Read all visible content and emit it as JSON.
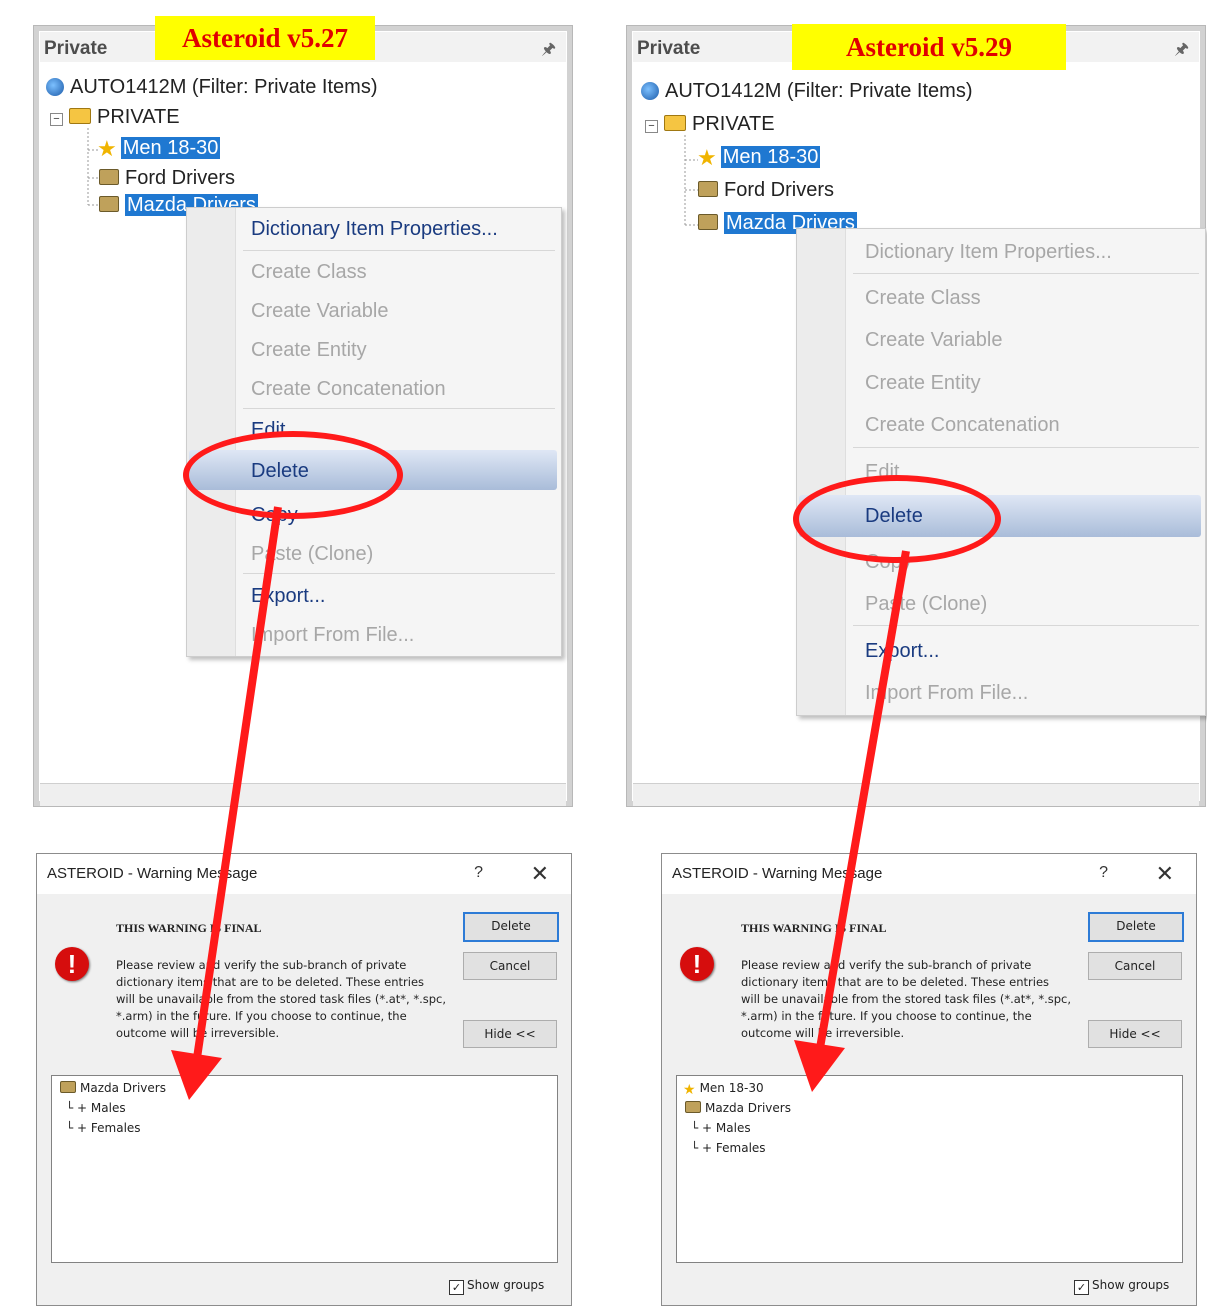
{
  "left": {
    "version": "Asteroid v5.27",
    "panel_title": "Private",
    "tree": {
      "root": "AUTO1412M (Filter: Private Items)",
      "folder": "PRIVATE",
      "items": [
        "Men 18-30",
        "Ford Drivers",
        "Mazda Drivers"
      ]
    },
    "menu": {
      "properties": "Dictionary Item Properties...",
      "create_class": "Create Class",
      "create_variable": "Create Variable",
      "create_entity": "Create Entity",
      "create_concatenation": "Create Concatenation",
      "edit": "Edit",
      "delete": "Delete",
      "copy": "Copy",
      "paste": "Paste (Clone)",
      "export": "Export...",
      "import": "Import From File..."
    },
    "dialog": {
      "title": "ASTEROID - Warning Message",
      "help": "?",
      "close": "✕",
      "heading": "THIS WARNING IS FINAL",
      "body": "Please review and verify the sub-branch of private dictionary items that are to be deleted. These entries will be unavailable from the stored task files (*.at*, *.spc, *.arm) in the future. If you choose to continue, the outcome will be irreversible.",
      "delete": "Delete",
      "cancel": "Cancel",
      "hide": "Hide <<",
      "list": [
        "Mazda Drivers",
        "Males",
        "Females"
      ],
      "show_groups": "Show groups"
    }
  },
  "right": {
    "version": "Asteroid v5.29",
    "panel_title": "Private",
    "tree": {
      "root": "AUTO1412M (Filter: Private Items)",
      "folder": "PRIVATE",
      "items": [
        "Men 18-30",
        "Ford Drivers",
        "Mazda Drivers"
      ]
    },
    "menu": {
      "properties": "Dictionary Item Properties...",
      "create_class": "Create Class",
      "create_variable": "Create Variable",
      "create_entity": "Create Entity",
      "create_concatenation": "Create Concatenation",
      "edit": "Edit",
      "delete": "Delete",
      "copy": "Copy",
      "paste": "Paste (Clone)",
      "export": "Export...",
      "import": "Import From File..."
    },
    "dialog": {
      "title": "ASTEROID - Warning Message",
      "help": "?",
      "close": "✕",
      "heading": "THIS WARNING IS FINAL",
      "body": "Please review and verify the sub-branch of private dictionary items that are to be deleted. These entries will be unavailable from the stored task files (*.at*, *.spc, *.arm) in the future. If you choose to continue, the outcome will be irreversible.",
      "delete": "Delete",
      "cancel": "Cancel",
      "hide": "Hide <<",
      "list": [
        "Men 18-30",
        "Mazda Drivers",
        "Males",
        "Females"
      ],
      "show_groups": "Show groups"
    }
  },
  "colors": {
    "version_bg": "#ffff00",
    "version_text": "#e00000",
    "selection": "#1f78d1",
    "annotation": "#ff1a1a"
  }
}
